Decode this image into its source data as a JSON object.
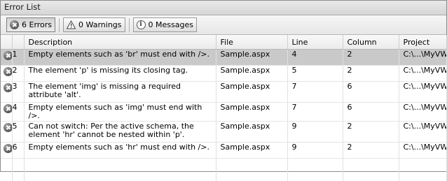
{
  "window": {
    "title": "Error List"
  },
  "toolbar": {
    "errors_label": "6 Errors",
    "warnings_label": "0 Warnings",
    "messages_label": "0 Messages"
  },
  "columns": {
    "icon": "",
    "number": "",
    "description": "Description",
    "file": "File",
    "line": "Line",
    "column": "Column",
    "project": "Project"
  },
  "rows": [
    {
      "num": "1",
      "description": "Empty elements such as 'br' must end with />.",
      "file": "Sample.aspx",
      "line": "4",
      "column": "2",
      "project": "C:\\...\\MyVWDSite"
    },
    {
      "num": "2",
      "description": "The element 'p' is missing its closing tag.",
      "file": "Sample.aspx",
      "line": "5",
      "column": "2",
      "project": "C:\\...\\MyVWDSite"
    },
    {
      "num": "3",
      "description": "The element 'img' is missing a required attribute 'alt'.",
      "file": "Sample.aspx",
      "line": "7",
      "column": "6",
      "project": "C:\\...\\MyVWDSite"
    },
    {
      "num": "4",
      "description": "Empty elements such as 'img' must end with />.",
      "file": "Sample.aspx",
      "line": "7",
      "column": "6",
      "project": "C:\\...\\MyVWDSite"
    },
    {
      "num": "5",
      "description": "Can not switch: Per the active schema, the element 'hr' cannot be nested within 'p'.",
      "file": "Sample.aspx",
      "line": "9",
      "column": "2",
      "project": "C:\\...\\MyVWDSite"
    },
    {
      "num": "6",
      "description": "Empty elements such as 'hr' must end with />.",
      "file": "Sample.aspx",
      "line": "9",
      "column": "2",
      "project": "C:\\...\\MyVWDSite"
    }
  ],
  "icons": {
    "error": "error-icon",
    "warning": "warning-icon",
    "message": "info-icon"
  },
  "colors": {
    "selected_row": "#c9c9c9",
    "header_bg": "#ebebeb",
    "titlebar_bg": "#d6d6d6"
  }
}
